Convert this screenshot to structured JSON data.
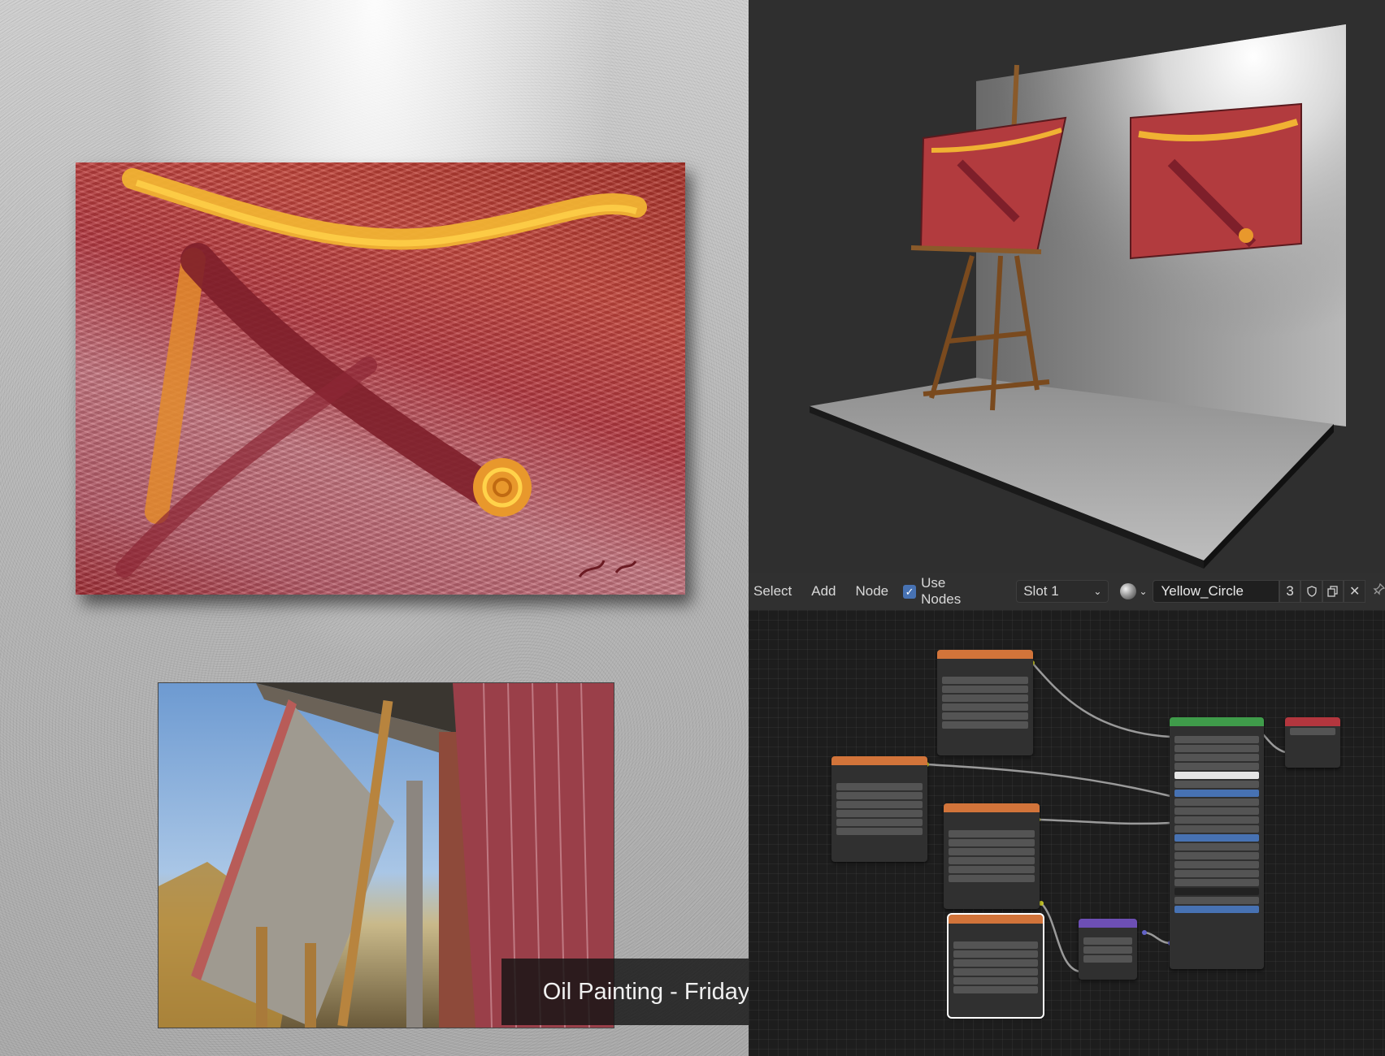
{
  "caption": "Oil Painting - Friday Evening",
  "node_editor": {
    "menu": [
      "Select",
      "Add",
      "Node"
    ],
    "use_nodes_label": "Use Nodes",
    "use_nodes_checked": true,
    "slot": "Slot 1",
    "material_name": "Yellow_Circle",
    "material_users": "3"
  },
  "colors": {
    "accent_blue": "#4772b3",
    "image_node_header": "#d2743a",
    "bsdf_header": "#3f9c4a",
    "output_header": "#b3363e",
    "normal_map_header": "#6d4fb5"
  }
}
